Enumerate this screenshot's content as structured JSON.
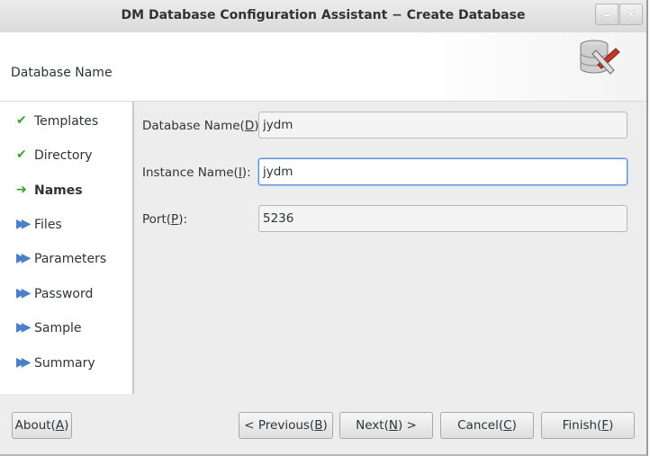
{
  "window": {
    "title": "DM Database Configuration Assistant − Create Database",
    "min_glyph": "–",
    "close_glyph": "✕"
  },
  "header": {
    "title": "Database Name",
    "icon": "database-tools-icon"
  },
  "steps": [
    {
      "label": "Templates",
      "status": "done",
      "glyph": "✔"
    },
    {
      "label": "Directory",
      "status": "done",
      "glyph": "✔"
    },
    {
      "label": "Names",
      "status": "current",
      "glyph": "➔"
    },
    {
      "label": "Files",
      "status": "pending",
      "glyph": "▶▶"
    },
    {
      "label": "Parameters",
      "status": "pending",
      "glyph": "▶▶"
    },
    {
      "label": "Password",
      "status": "pending",
      "glyph": "▶▶"
    },
    {
      "label": "Sample",
      "status": "pending",
      "glyph": "▶▶"
    },
    {
      "label": "Summary",
      "status": "pending",
      "glyph": "▶▶"
    }
  ],
  "form": {
    "db_name": {
      "label": "Database Name(",
      "key": "D",
      "suffix": "):",
      "value": "jydm"
    },
    "instance_name": {
      "label": "Instance Name(",
      "key": "I",
      "suffix": "):",
      "value": "jydm"
    },
    "port": {
      "label": "Port(",
      "key": "P",
      "suffix": "):",
      "value": "5236"
    }
  },
  "buttons": {
    "about": {
      "label": "About(",
      "key": "A",
      "suffix": ")"
    },
    "previous": {
      "label": "< Previous(",
      "key": "B",
      "suffix": ")"
    },
    "next": {
      "label": "Next(",
      "key": "N",
      "suffix": ") >"
    },
    "cancel": {
      "label": "Cancel(",
      "key": "C",
      "suffix": ")"
    },
    "finish": {
      "label": "Finish(",
      "key": "F",
      "suffix": ")"
    }
  },
  "colors": {
    "check": "#3aa130",
    "arrow": "#2e9e2e",
    "pending": "#4b7fc6",
    "focus": "#5a8fd0"
  }
}
